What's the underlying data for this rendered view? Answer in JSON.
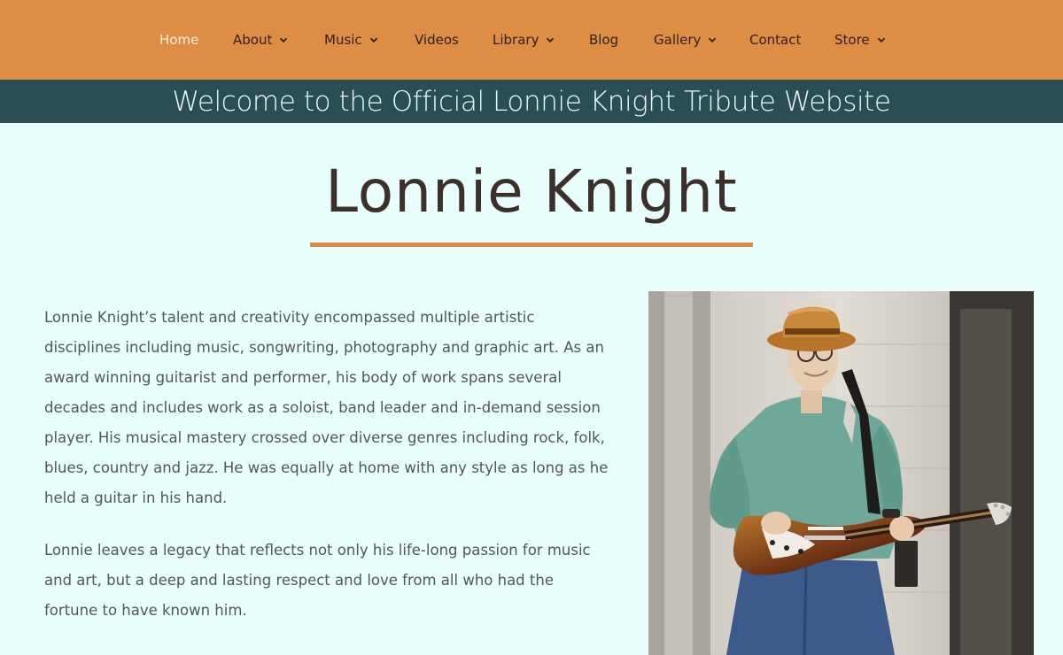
{
  "nav": {
    "items": [
      {
        "label": "Home",
        "dropdown": false,
        "active": true
      },
      {
        "label": "About",
        "dropdown": true,
        "active": false
      },
      {
        "label": "Music",
        "dropdown": true,
        "active": false
      },
      {
        "label": "Videos",
        "dropdown": false,
        "active": false
      },
      {
        "label": "Library",
        "dropdown": true,
        "active": false
      },
      {
        "label": "Blog",
        "dropdown": false,
        "active": false
      },
      {
        "label": "Gallery",
        "dropdown": true,
        "active": false
      },
      {
        "label": "Contact",
        "dropdown": false,
        "active": false
      },
      {
        "label": "Store",
        "dropdown": true,
        "active": false
      }
    ]
  },
  "banner": {
    "text": "Welcome to the Official Lonnie Knight Tribute Website"
  },
  "main": {
    "title": "Lonnie Knight",
    "paragraphs": [
      "Lonnie Knight’s talent and creativity encompassed multiple artistic disciplines including music, songwriting, photography and graphic art. As an award winning guitarist and performer, his body of work spans several decades and includes work as a soloist, band leader and in-demand session player. His musical mastery crossed over diverse genres including rock, folk, blues, country and jazz. He was equally at home with any style as long as he held a guitar in his hand.",
      "Lonnie leaves a legacy that reflects not only his life-long passion for music and art, but a deep and lasting respect and love from all who had the fortune to have known him."
    ]
  },
  "colors": {
    "nav_bg": "#de8d44",
    "banner_bg": "#2b4e54",
    "page_bg": "#e8fffd",
    "accent_rule": "#d98c47"
  },
  "icons": {
    "dropdown": "chevron-down-icon"
  }
}
